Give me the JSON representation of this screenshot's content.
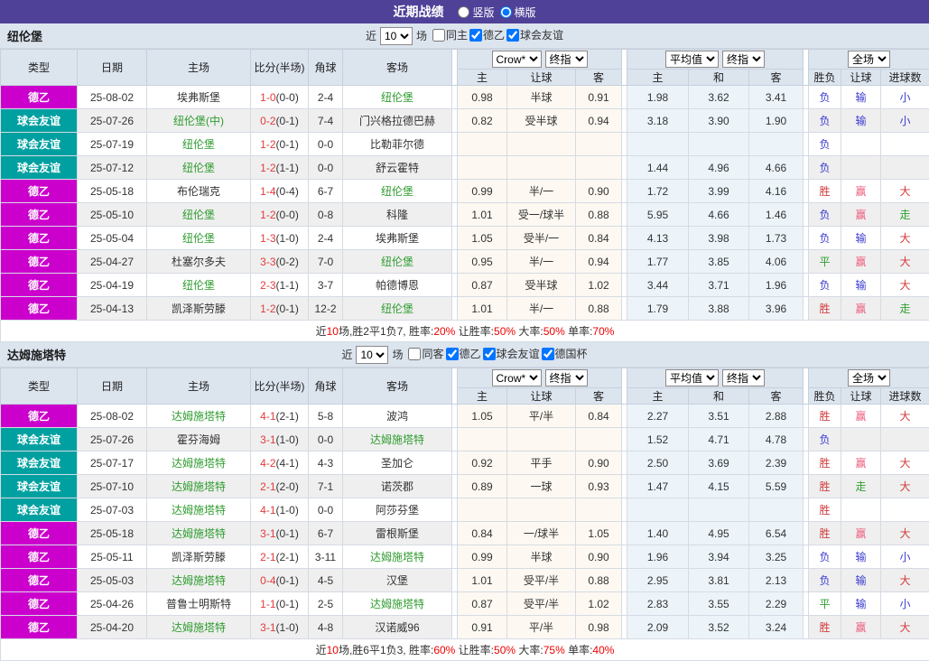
{
  "title_bar": {
    "title": "近期战绩",
    "radio_vertical": "竖版",
    "radio_horizontal": "横版"
  },
  "filter_labels": {
    "near": "近",
    "matches": "场"
  },
  "columns": {
    "type": "类型",
    "date": "日期",
    "home": "主场",
    "score": "比分(半场)",
    "corners": "角球",
    "away": "客场",
    "odds_home": "主",
    "odds_handicap": "让球",
    "odds_away": "客",
    "avg_home": "主",
    "avg_draw": "和",
    "avg_away": "客",
    "result": "胜负",
    "handicap_result": "让球",
    "goals": "进球数"
  },
  "dropdowns": {
    "source": "Crow*",
    "final": "终指",
    "average": "平均值",
    "scope": "全场"
  },
  "palette": {
    "red": "#d33a3a",
    "pink": "#ed5e7e",
    "blue": "#3b3bd0",
    "green": "#2f9e2f"
  },
  "league_colors": {
    "德乙": "#cc00cc",
    "球会友谊": "#00a0a0"
  },
  "sections": [
    {
      "team": "纽伦堡",
      "near_count": "10",
      "filters": [
        {
          "label": "同主",
          "checked": false
        },
        {
          "label": "德乙",
          "checked": true
        },
        {
          "label": "球会友谊",
          "checked": true
        }
      ],
      "rows": [
        {
          "league": "德乙",
          "league_color": "#cc00cc",
          "date": "25-08-02",
          "home": "埃弗斯堡",
          "home_focus": false,
          "score": "1-0",
          "half": "(0-0)",
          "corners": "2-4",
          "away": "纽伦堡",
          "away_focus": true,
          "crow": [
            "0.98",
            "半球",
            "0.91"
          ],
          "avg": [
            "1.98",
            "3.62",
            "3.41"
          ],
          "results": [
            {
              "text": "负",
              "color": "blue"
            },
            {
              "text": "输",
              "color": "blue"
            },
            {
              "text": "小",
              "color": "blue"
            }
          ]
        },
        {
          "league": "球会友谊",
          "league_color": "#00a0a0",
          "date": "25-07-26",
          "home": "纽伦堡(中)",
          "home_focus": true,
          "score": "0-2",
          "half": "(0-1)",
          "corners": "7-4",
          "away": "门兴格拉德巴赫",
          "away_focus": false,
          "crow": [
            "0.82",
            "受半球",
            "0.94"
          ],
          "avg": [
            "3.18",
            "3.90",
            "1.90"
          ],
          "results": [
            {
              "text": "负",
              "color": "blue"
            },
            {
              "text": "输",
              "color": "blue"
            },
            {
              "text": "小",
              "color": "blue"
            }
          ]
        },
        {
          "league": "球会友谊",
          "league_color": "#00a0a0",
          "date": "25-07-19",
          "home": "纽伦堡",
          "home_focus": true,
          "score": "1-2",
          "half": "(0-1)",
          "corners": "0-0",
          "away": "比勒菲尔德",
          "away_focus": false,
          "crow": [
            "",
            "",
            ""
          ],
          "avg": [
            "",
            "",
            ""
          ],
          "results": [
            {
              "text": "负",
              "color": "blue"
            },
            null,
            null
          ]
        },
        {
          "league": "球会友谊",
          "league_color": "#00a0a0",
          "date": "25-07-12",
          "home": "纽伦堡",
          "home_focus": true,
          "score": "1-2",
          "half": "(1-1)",
          "corners": "0-0",
          "away": "舒云霍特",
          "away_focus": false,
          "crow": [
            "",
            "",
            ""
          ],
          "avg": [
            "1.44",
            "4.96",
            "4.66"
          ],
          "results": [
            {
              "text": "负",
              "color": "blue"
            },
            null,
            null
          ]
        },
        {
          "league": "德乙",
          "league_color": "#cc00cc",
          "date": "25-05-18",
          "home": "布伦瑞克",
          "home_focus": false,
          "score": "1-4",
          "half": "(0-4)",
          "corners": "6-7",
          "away": "纽伦堡",
          "away_focus": true,
          "crow": [
            "0.99",
            "半/一",
            "0.90"
          ],
          "avg": [
            "1.72",
            "3.99",
            "4.16"
          ],
          "results": [
            {
              "text": "胜",
              "color": "red"
            },
            {
              "text": "赢",
              "color": "pink"
            },
            {
              "text": "大",
              "color": "red"
            }
          ]
        },
        {
          "league": "德乙",
          "league_color": "#cc00cc",
          "date": "25-05-10",
          "home": "纽伦堡",
          "home_focus": true,
          "score": "1-2",
          "half": "(0-0)",
          "corners": "0-8",
          "away": "科隆",
          "away_focus": false,
          "crow": [
            "1.01",
            "受一/球半",
            "0.88"
          ],
          "avg": [
            "5.95",
            "4.66",
            "1.46"
          ],
          "results": [
            {
              "text": "负",
              "color": "blue"
            },
            {
              "text": "赢",
              "color": "pink"
            },
            {
              "text": "走",
              "color": "green"
            }
          ]
        },
        {
          "league": "德乙",
          "league_color": "#cc00cc",
          "date": "25-05-04",
          "home": "纽伦堡",
          "home_focus": true,
          "score": "1-3",
          "half": "(1-0)",
          "corners": "2-4",
          "away": "埃弗斯堡",
          "away_focus": false,
          "crow": [
            "1.05",
            "受半/一",
            "0.84"
          ],
          "avg": [
            "4.13",
            "3.98",
            "1.73"
          ],
          "results": [
            {
              "text": "负",
              "color": "blue"
            },
            {
              "text": "输",
              "color": "blue"
            },
            {
              "text": "大",
              "color": "red"
            }
          ]
        },
        {
          "league": "德乙",
          "league_color": "#cc00cc",
          "date": "25-04-27",
          "home": "杜塞尔多夫",
          "home_focus": false,
          "score": "3-3",
          "half": "(0-2)",
          "corners": "7-0",
          "away": "纽伦堡",
          "away_focus": true,
          "crow": [
            "0.95",
            "半/一",
            "0.94"
          ],
          "avg": [
            "1.77",
            "3.85",
            "4.06"
          ],
          "results": [
            {
              "text": "平",
              "color": "green"
            },
            {
              "text": "赢",
              "color": "pink"
            },
            {
              "text": "大",
              "color": "red"
            }
          ]
        },
        {
          "league": "德乙",
          "league_color": "#cc00cc",
          "date": "25-04-19",
          "home": "纽伦堡",
          "home_focus": true,
          "score": "2-3",
          "half": "(1-1)",
          "corners": "3-7",
          "away": "帕德博恩",
          "away_focus": false,
          "crow": [
            "0.87",
            "受半球",
            "1.02"
          ],
          "avg": [
            "3.44",
            "3.71",
            "1.96"
          ],
          "results": [
            {
              "text": "负",
              "color": "blue"
            },
            {
              "text": "输",
              "color": "blue"
            },
            {
              "text": "大",
              "color": "red"
            }
          ]
        },
        {
          "league": "德乙",
          "league_color": "#cc00cc",
          "date": "25-04-13",
          "home": "凯泽斯劳滕",
          "home_focus": false,
          "score": "1-2",
          "half": "(0-1)",
          "corners": "12-2",
          "away": "纽伦堡",
          "away_focus": true,
          "crow": [
            "1.01",
            "半/一",
            "0.88"
          ],
          "avg": [
            "1.79",
            "3.88",
            "3.96"
          ],
          "results": [
            {
              "text": "胜",
              "color": "red"
            },
            {
              "text": "赢",
              "color": "pink"
            },
            {
              "text": "走",
              "color": "green"
            }
          ]
        }
      ],
      "summary": [
        {
          "text": "近",
          "red": false
        },
        {
          "text": "10",
          "red": true
        },
        {
          "text": "场,胜2平1负7, 胜率:",
          "red": false
        },
        {
          "text": "20%",
          "red": true
        },
        {
          "text": " 让胜率:",
          "red": false
        },
        {
          "text": "50%",
          "red": true
        },
        {
          "text": " 大率:",
          "red": false
        },
        {
          "text": "50%",
          "red": true
        },
        {
          "text": " 单率:",
          "red": false
        },
        {
          "text": "70%",
          "red": true
        }
      ]
    },
    {
      "team": "达姆施塔特",
      "near_count": "10",
      "filters": [
        {
          "label": "同客",
          "checked": false
        },
        {
          "label": "德乙",
          "checked": true
        },
        {
          "label": "球会友谊",
          "checked": true
        },
        {
          "label": "德国杯",
          "checked": true
        }
      ],
      "rows": [
        {
          "league": "德乙",
          "league_color": "#cc00cc",
          "date": "25-08-02",
          "home": "达姆施塔特",
          "home_focus": true,
          "score": "4-1",
          "half": "(2-1)",
          "corners": "5-8",
          "away": "波鸿",
          "away_focus": false,
          "crow": [
            "1.05",
            "平/半",
            "0.84"
          ],
          "avg": [
            "2.27",
            "3.51",
            "2.88"
          ],
          "results": [
            {
              "text": "胜",
              "color": "red"
            },
            {
              "text": "赢",
              "color": "pink"
            },
            {
              "text": "大",
              "color": "red"
            }
          ]
        },
        {
          "league": "球会友谊",
          "league_color": "#00a0a0",
          "date": "25-07-26",
          "home": "霍芬海姆",
          "home_focus": false,
          "score": "3-1",
          "half": "(1-0)",
          "corners": "0-0",
          "away": "达姆施塔特",
          "away_focus": true,
          "crow": [
            "",
            "",
            ""
          ],
          "avg": [
            "1.52",
            "4.71",
            "4.78"
          ],
          "results": [
            {
              "text": "负",
              "color": "blue"
            },
            null,
            null
          ]
        },
        {
          "league": "球会友谊",
          "league_color": "#00a0a0",
          "date": "25-07-17",
          "home": "达姆施塔特",
          "home_focus": true,
          "score": "4-2",
          "half": "(4-1)",
          "corners": "4-3",
          "away": "圣加仑",
          "away_focus": false,
          "crow": [
            "0.92",
            "平手",
            "0.90"
          ],
          "avg": [
            "2.50",
            "3.69",
            "2.39"
          ],
          "results": [
            {
              "text": "胜",
              "color": "red"
            },
            {
              "text": "赢",
              "color": "pink"
            },
            {
              "text": "大",
              "color": "red"
            }
          ]
        },
        {
          "league": "球会友谊",
          "league_color": "#00a0a0",
          "date": "25-07-10",
          "home": "达姆施塔特",
          "home_focus": true,
          "score": "2-1",
          "half": "(2-0)",
          "corners": "7-1",
          "away": "诺茨郡",
          "away_focus": false,
          "crow": [
            "0.89",
            "一球",
            "0.93"
          ],
          "avg": [
            "1.47",
            "4.15",
            "5.59"
          ],
          "results": [
            {
              "text": "胜",
              "color": "red"
            },
            {
              "text": "走",
              "color": "green"
            },
            {
              "text": "大",
              "color": "red"
            }
          ]
        },
        {
          "league": "球会友谊",
          "league_color": "#00a0a0",
          "date": "25-07-03",
          "home": "达姆施塔特",
          "home_focus": true,
          "score": "4-1",
          "half": "(1-0)",
          "corners": "0-0",
          "away": "阿莎芬堡",
          "away_focus": false,
          "crow": [
            "",
            "",
            ""
          ],
          "avg": [
            "",
            "",
            ""
          ],
          "results": [
            {
              "text": "胜",
              "color": "red"
            },
            null,
            null
          ]
        },
        {
          "league": "德乙",
          "league_color": "#cc00cc",
          "date": "25-05-18",
          "home": "达姆施塔特",
          "home_focus": true,
          "score": "3-1",
          "half": "(0-1)",
          "corners": "6-7",
          "away": "雷根斯堡",
          "away_focus": false,
          "crow": [
            "0.84",
            "一/球半",
            "1.05"
          ],
          "avg": [
            "1.40",
            "4.95",
            "6.54"
          ],
          "results": [
            {
              "text": "胜",
              "color": "red"
            },
            {
              "text": "赢",
              "color": "pink"
            },
            {
              "text": "大",
              "color": "red"
            }
          ]
        },
        {
          "league": "德乙",
          "league_color": "#cc00cc",
          "date": "25-05-11",
          "home": "凯泽斯劳滕",
          "home_focus": false,
          "score": "2-1",
          "half": "(2-1)",
          "corners": "3-11",
          "away": "达姆施塔特",
          "away_focus": true,
          "crow": [
            "0.99",
            "半球",
            "0.90"
          ],
          "avg": [
            "1.96",
            "3.94",
            "3.25"
          ],
          "results": [
            {
              "text": "负",
              "color": "blue"
            },
            {
              "text": "输",
              "color": "blue"
            },
            {
              "text": "小",
              "color": "blue"
            }
          ]
        },
        {
          "league": "德乙",
          "league_color": "#cc00cc",
          "date": "25-05-03",
          "home": "达姆施塔特",
          "home_focus": true,
          "score": "0-4",
          "half": "(0-1)",
          "corners": "4-5",
          "away": "汉堡",
          "away_focus": false,
          "crow": [
            "1.01",
            "受平/半",
            "0.88"
          ],
          "avg": [
            "2.95",
            "3.81",
            "2.13"
          ],
          "results": [
            {
              "text": "负",
              "color": "blue"
            },
            {
              "text": "输",
              "color": "blue"
            },
            {
              "text": "大",
              "color": "red"
            }
          ]
        },
        {
          "league": "德乙",
          "league_color": "#cc00cc",
          "date": "25-04-26",
          "home": "普鲁士明斯特",
          "home_focus": false,
          "score": "1-1",
          "half": "(0-1)",
          "corners": "2-5",
          "away": "达姆施塔特",
          "away_focus": true,
          "crow": [
            "0.87",
            "受平/半",
            "1.02"
          ],
          "avg": [
            "2.83",
            "3.55",
            "2.29"
          ],
          "results": [
            {
              "text": "平",
              "color": "green"
            },
            {
              "text": "输",
              "color": "blue"
            },
            {
              "text": "小",
              "color": "blue"
            }
          ]
        },
        {
          "league": "德乙",
          "league_color": "#cc00cc",
          "date": "25-04-20",
          "home": "达姆施塔特",
          "home_focus": true,
          "score": "3-1",
          "half": "(1-0)",
          "corners": "4-8",
          "away": "汉诺威96",
          "away_focus": false,
          "crow": [
            "0.91",
            "平/半",
            "0.98"
          ],
          "avg": [
            "2.09",
            "3.52",
            "3.24"
          ],
          "results": [
            {
              "text": "胜",
              "color": "red"
            },
            {
              "text": "赢",
              "color": "pink"
            },
            {
              "text": "大",
              "color": "red"
            }
          ]
        }
      ],
      "summary": [
        {
          "text": "近",
          "red": false
        },
        {
          "text": "10",
          "red": true
        },
        {
          "text": "场,胜6平1负3, 胜率:",
          "red": false
        },
        {
          "text": "60%",
          "red": true
        },
        {
          "text": " 让胜率:",
          "red": false
        },
        {
          "text": "50%",
          "red": true
        },
        {
          "text": " 大率:",
          "red": false
        },
        {
          "text": "75%",
          "red": true
        },
        {
          "text": " 单率:",
          "red": false
        },
        {
          "text": "40%",
          "red": true
        }
      ]
    }
  ]
}
